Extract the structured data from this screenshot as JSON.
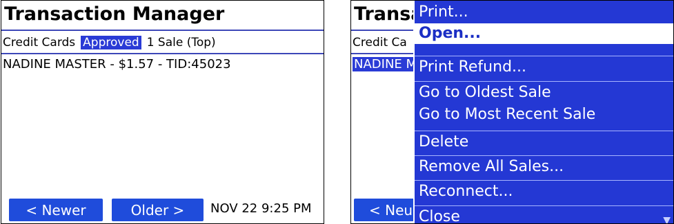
{
  "left_screen": {
    "title": "Transaction Manager",
    "filter": {
      "category": "Credit Cards",
      "status": "Approved",
      "count": "1 Sale (Top)"
    },
    "rows": [
      "NADINE MASTER  -  $1.57  -  TID:45023"
    ],
    "newer_button": "< Newer",
    "older_button": "Older >",
    "datetime": "NOV 22 9:25 PM"
  },
  "right_screen": {
    "title": "Transa",
    "filter_category": "Credit Ca",
    "row_fragment": "NADINE M",
    "newer_button": "< Neu",
    "menu": {
      "items": [
        "Print...",
        "Open...",
        "Print Refund...",
        "Go to Oldest Sale",
        "Go to Most Recent Sale",
        "Delete",
        "Remove All Sales...",
        "Reconnect...",
        "Close"
      ],
      "selected": "Open..."
    }
  },
  "colors": {
    "accent": "#2a3bd6",
    "button": "#1f4cdb",
    "menu_bg": "#2438d4",
    "rule": "#3c46b8"
  }
}
